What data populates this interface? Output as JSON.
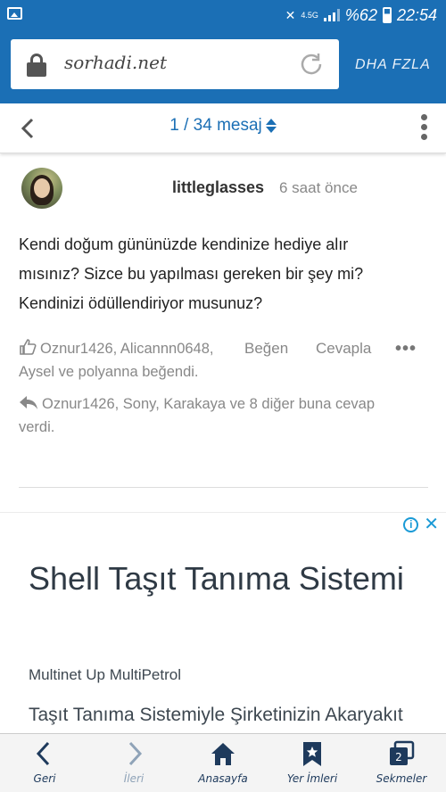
{
  "status_bar": {
    "network": "4.5G",
    "battery_text": "%62",
    "time": "22:54"
  },
  "browser": {
    "url": "sorhadi.net",
    "more_label": "DHA FZLA"
  },
  "thread": {
    "counter": "1 / 34 mesaj"
  },
  "post": {
    "username": "littleglasses",
    "time_ago": "6 saat önce",
    "body": "Kendi doğum gününüzde kendinize hediye alır mısınız? Sizce bu yapılması gereken bir şey mi? Kendinizi ödüllendiriyor musunuz?",
    "likers_line1": "Oznur1426, Alicannn0648,",
    "likers_line2": "Aysel ve polyanna beğendi.",
    "like_label": "Beğen",
    "reply_label": "Cevapla",
    "more_label": "•••",
    "replies_text": "Oznur1426, Sony, Karakaya ve 8 diğer buna cevap verdi."
  },
  "ad": {
    "title": "Shell Taşıt Tanıma Sistemi",
    "subtitle": "Multinet Up MultiPetrol",
    "description": "Taşıt Tanıma Sistemiyle Şirketinizin Akaryakıt Giderlerini Tamamen Kontrol Edin",
    "info_icon": "i",
    "close_icon": "✕"
  },
  "bottom_nav": {
    "back": "Geri",
    "forward": "İleri",
    "home": "Anasayfa",
    "bookmarks": "Yer İmleri",
    "tabs": "Sekmeler",
    "tabs_count": "2"
  }
}
